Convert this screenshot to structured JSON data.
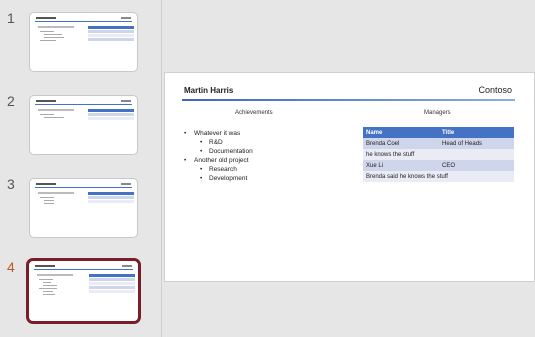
{
  "thumbnails": [
    {
      "number": "1",
      "active": false
    },
    {
      "number": "2",
      "active": false
    },
    {
      "number": "3",
      "active": false
    },
    {
      "number": "4",
      "active": true
    }
  ],
  "slide": {
    "title": "Martin Harris",
    "brand": "Contoso",
    "left_heading": "Achievements",
    "right_heading": "Managers",
    "bullets": [
      {
        "level": 1,
        "text": "Whatever it was"
      },
      {
        "level": 2,
        "text": "R&D"
      },
      {
        "level": 2,
        "text": "Documentation"
      },
      {
        "level": 1,
        "text": "Another old project"
      },
      {
        "level": 2,
        "text": "Research"
      },
      {
        "level": 2,
        "text": "Development"
      }
    ],
    "table": {
      "headers": [
        "Name",
        "Title"
      ],
      "rows": [
        {
          "cells": [
            "Brenda Coel",
            "Head of Heads"
          ],
          "merged": false
        },
        {
          "cells": [
            "he knows the stuff"
          ],
          "merged": true
        },
        {
          "cells": [
            "Xue Li",
            "CEO"
          ],
          "merged": false
        },
        {
          "cells": [
            "Brenda said he knows the stuff"
          ],
          "merged": true
        }
      ]
    }
  },
  "colors": {
    "accent": "#4472c4",
    "selection_border": "#7a1c2a",
    "active_number": "#b85a1e"
  }
}
